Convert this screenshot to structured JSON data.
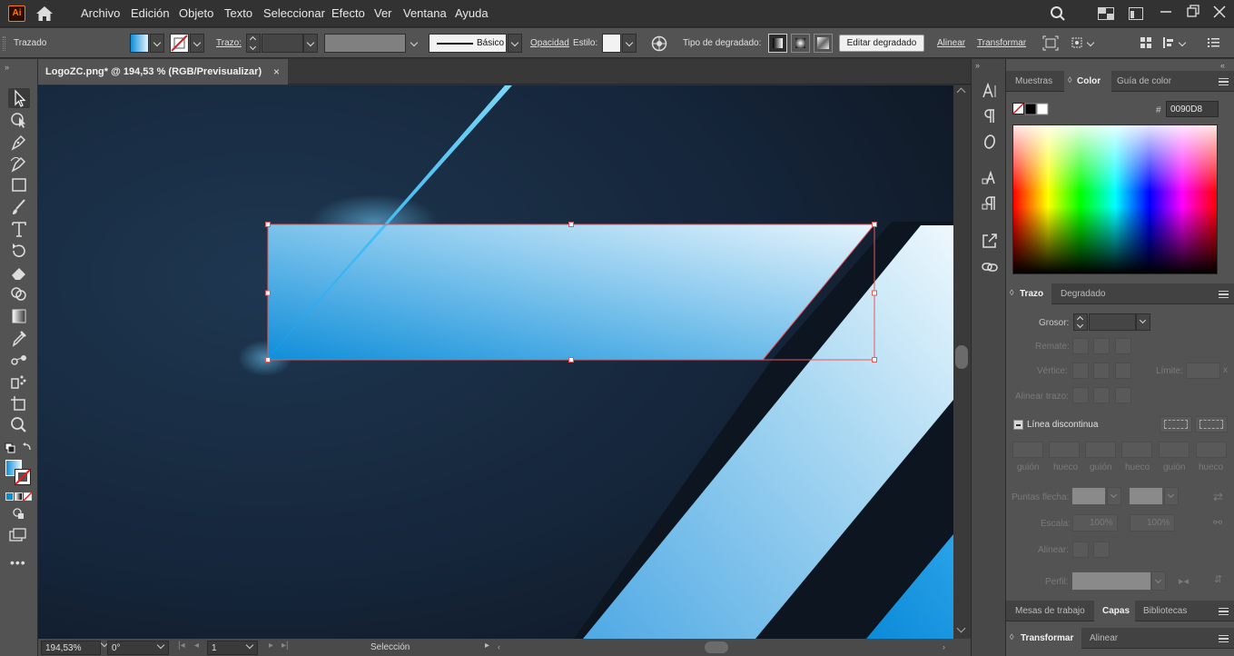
{
  "app": {
    "logo": "Ai"
  },
  "menu": [
    "Archivo",
    "Edición",
    "Objeto",
    "Texto",
    "Seleccionar",
    "Efecto",
    "Ver",
    "Ventana",
    "Ayuda"
  ],
  "control_bar": {
    "object_label": "Trazado",
    "stroke_label": "Trazo:",
    "profile_label": "Básico",
    "opacity_label": "Opacidad",
    "style_label": "Estilo:",
    "gradient_type_label": "Tipo de degradado:",
    "edit_gradient_button": "Editar degradado",
    "align_link": "Alinear",
    "transform_link": "Transformar"
  },
  "document": {
    "tab_title": "LogoZC.png* @ 194,53 % (RGB/Previsualizar)",
    "close_glyph": "×"
  },
  "status_bar": {
    "zoom": "194,53%",
    "rotation": "0°",
    "artboard": "1",
    "tool_name": "Selección"
  },
  "color_panel": {
    "tabs": [
      "Muestras",
      "Color",
      "Guía de color"
    ],
    "active_tab": "Color",
    "hex_label": "#",
    "hex_value": "0090D8"
  },
  "stroke_panel": {
    "tabs": [
      "Trazo",
      "Degradado"
    ],
    "active_tab": "Trazo",
    "weight_label": "Grosor:",
    "cap_label": "Remate:",
    "corner_label": "Vértice:",
    "limit_label": "Límite:",
    "align_label": "Alinear trazo:",
    "dashed_label": "Línea discontinua",
    "dash_labels": [
      "guión",
      "hueco",
      "guión",
      "hueco",
      "guión",
      "hueco"
    ],
    "arrowheads_label": "Puntas flecha:",
    "scale_label": "Escala:",
    "scale_values": [
      "100%",
      "100%"
    ],
    "align_arrow_label": "Alinear:",
    "profile_label": "Perfil:"
  },
  "bottom_panels": {
    "tabs": [
      "Mesas de trabajo",
      "Capas",
      "Bibliotecas"
    ],
    "active_tab": "Capas",
    "tabs2": [
      "Transformar",
      "Alinear"
    ],
    "active_tab2": "Transformar"
  },
  "colors": {
    "fill_gradient_start": "#0f8ed9",
    "fill_gradient_end": "#e6f4fc",
    "selection": "#e8585a",
    "hex": "#0090D8"
  }
}
